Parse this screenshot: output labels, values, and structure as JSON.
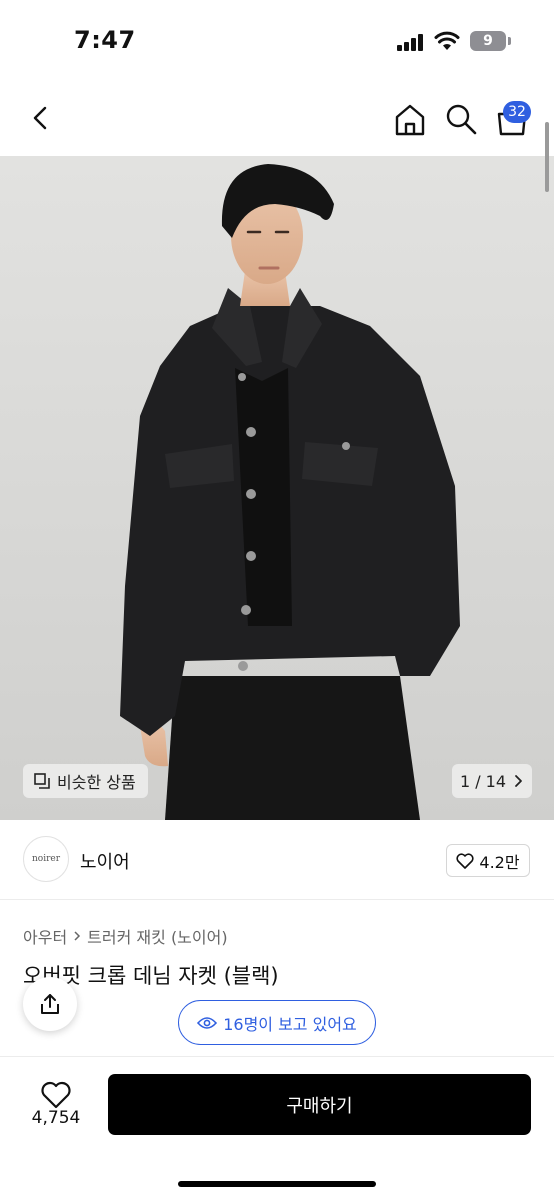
{
  "status_bar": {
    "time": "7:47",
    "battery": "9"
  },
  "header": {
    "cart_count": "32"
  },
  "hero": {
    "similar_label": "비슷한 상품",
    "page_indicator": "1 / 14"
  },
  "brand": {
    "logo_text": "noirer",
    "name": "노이어",
    "likes": "4.2만"
  },
  "breadcrumb": {
    "category": "아우터",
    "subcategory": "트러커 재킷 (노이어)"
  },
  "product": {
    "title": "오버핏 크롭 데님 자켓 (블랙)"
  },
  "viewers": {
    "label": "16명이 보고 있어요"
  },
  "bottom_bar": {
    "wishlist_count": "4,754",
    "buy_label": "구매하기"
  },
  "colors": {
    "accent": "#2f5fe0",
    "buy_button": "#000000",
    "background": "#ffffff"
  }
}
